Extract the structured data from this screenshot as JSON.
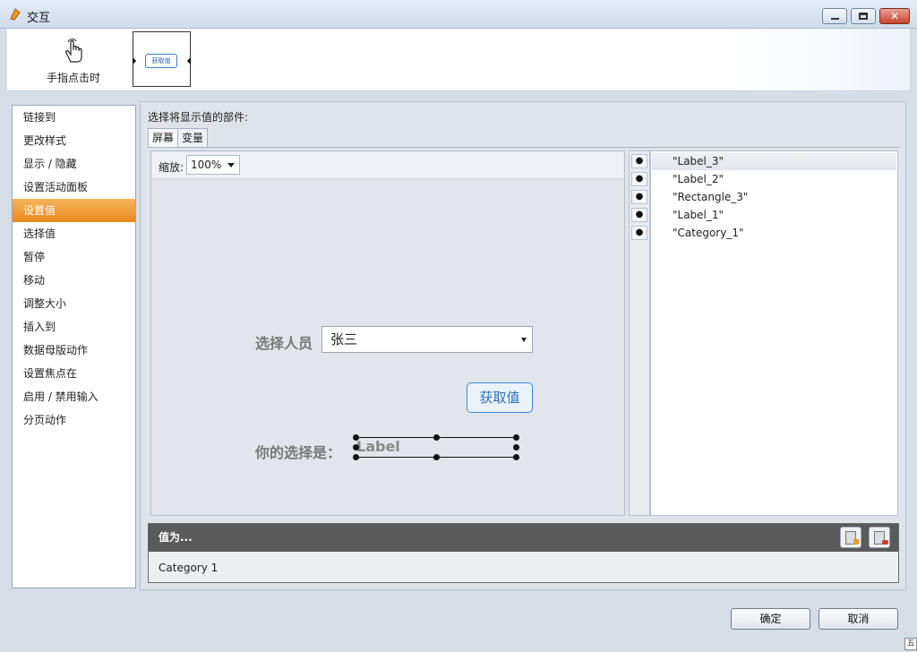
{
  "window": {
    "title": "交互",
    "minimize": "–",
    "maximize": "□",
    "close": "✕"
  },
  "toolbar": {
    "trigger_label": "手指点击时",
    "thumb_text": "获取值"
  },
  "actions": [
    {
      "label": "链接到"
    },
    {
      "label": "更改样式"
    },
    {
      "label": "显示 / 隐藏"
    },
    {
      "label": "设置活动面板"
    },
    {
      "label": "设置值",
      "active": true
    },
    {
      "label": "选择值"
    },
    {
      "label": "暂停"
    },
    {
      "label": "移动"
    },
    {
      "label": "调整大小"
    },
    {
      "label": "插入到"
    },
    {
      "label": "数据母版动作"
    },
    {
      "label": "设置焦点在"
    },
    {
      "label": "启用 / 禁用输入"
    },
    {
      "label": "分页动作"
    }
  ],
  "main": {
    "prompt": "选择将显示值的部件:",
    "tabs": [
      {
        "label": "屏幕"
      },
      {
        "label": "变量"
      }
    ],
    "zoom_label": "缩放:",
    "zoom_value": "100%"
  },
  "canvas": {
    "person_label": "选择人员",
    "person_value": "张三",
    "button_label": "获取值",
    "choice_label": "你的选择是：",
    "label_placeholder": "Label"
  },
  "layers": [
    {
      "name": "\"Label_3\"",
      "selected": true
    },
    {
      "name": "\"Label_2\""
    },
    {
      "name": "\"Rectangle_3\""
    },
    {
      "name": "\"Label_1\""
    },
    {
      "name": "\"Category_1\""
    }
  ],
  "value_panel": {
    "header": "值为...",
    "value": "Category 1"
  },
  "footer": {
    "ok": "确定",
    "cancel": "取消"
  },
  "corner_glyph": "五",
  "colors": {
    "active_item": "#e98a1c",
    "button_border": "#3a88d9",
    "value_header": "#5a5a5a"
  }
}
